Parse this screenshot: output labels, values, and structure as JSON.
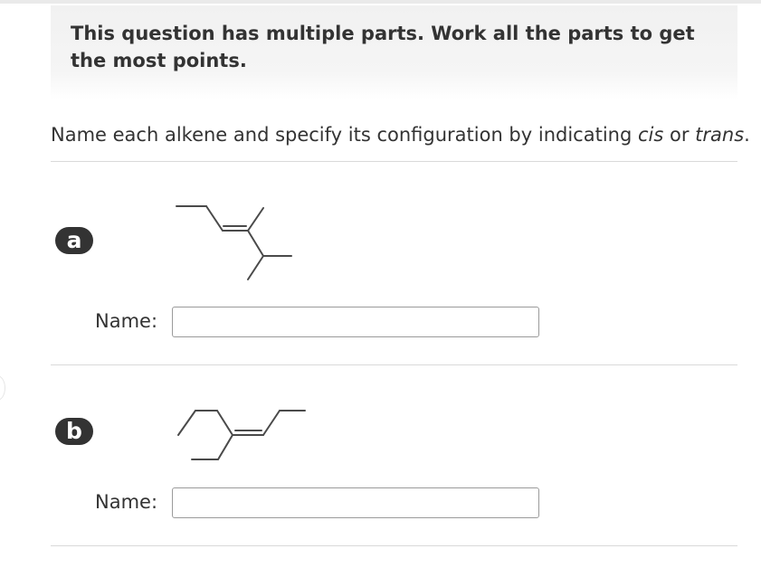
{
  "banner": {
    "text": "This question has multiple parts. Work all the parts to get the most points."
  },
  "prompt": {
    "lead": "Name each alkene and specify its configuration by indicating ",
    "cis": "cis",
    "middle": " or ",
    "trans": "trans",
    "end": "."
  },
  "parts": [
    {
      "badge": "a",
      "name_label": "Name:",
      "name_value": ""
    },
    {
      "badge": "b",
      "name_label": "Name:",
      "name_value": ""
    }
  ]
}
